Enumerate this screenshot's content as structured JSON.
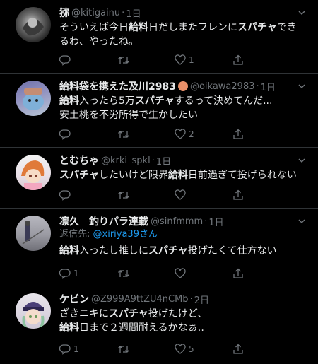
{
  "tweets": [
    {
      "name": "猕",
      "handle": "@kitigainu",
      "sep": "·",
      "time": "1日",
      "lines": [
        [
          {
            "t": "そういえば今日"
          },
          {
            "t": "給料",
            "b": true
          },
          {
            "t": "日だしまたフレンに"
          },
          {
            "t": "スパチャ",
            "b": true
          },
          {
            "t": "でき"
          }
        ],
        [
          {
            "t": "るわ、やったね。"
          }
        ]
      ],
      "reply_count": "",
      "retweet_count": "",
      "like_count": "1"
    },
    {
      "name": "給料袋を携えた及川2983",
      "handle": "@oikawa2983",
      "sep": "·",
      "time": "1日",
      "lines": [
        [
          {
            "t": "給料",
            "b": true
          },
          {
            "t": "入ったら5万"
          },
          {
            "t": "スパチャ",
            "b": true
          },
          {
            "t": "するって決めてんだ..."
          }
        ],
        [
          {
            "t": "安土桃を不労所得で生かしたい"
          }
        ]
      ],
      "reply_count": "",
      "retweet_count": "",
      "like_count": "2"
    },
    {
      "name": "とむちゃ",
      "handle": "@krki_spkl",
      "sep": "·",
      "time": "1日",
      "lines": [
        [
          {
            "t": "スパチャ",
            "b": true
          },
          {
            "t": "したいけど限界"
          },
          {
            "t": "給料",
            "b": true
          },
          {
            "t": "日前過ぎて投げられない"
          }
        ]
      ],
      "reply_count": "",
      "retweet_count": "",
      "like_count": ""
    },
    {
      "name": "凛久　釣りパラ連載",
      "handle": "@sinfmmm",
      "sep": "·",
      "time": "1日",
      "reply_prefix": "返信先: ",
      "reply_to": "@xiriya39さん",
      "lines": [
        [
          {
            "t": "給料",
            "b": true
          },
          {
            "t": "入ったし推しに"
          },
          {
            "t": "スパチャ",
            "b": true
          },
          {
            "t": "投げたくて仕方ない"
          }
        ]
      ],
      "reply_count": "1",
      "retweet_count": "",
      "like_count": ""
    },
    {
      "name": "ケビン",
      "handle": "@Z999A9ttZU4nCMb",
      "sep": "·",
      "time": "2日",
      "lines": [
        [
          {
            "t": "ざきニキに"
          },
          {
            "t": "スパチャ",
            "b": true
          },
          {
            "t": "投げたけど、"
          }
        ],
        [
          {
            "t": "給料",
            "b": true
          },
          {
            "t": "日まで２週間耐えるかなぁ‥"
          }
        ]
      ],
      "reply_count": "1",
      "retweet_count": "",
      "like_count": "5"
    }
  ],
  "colors": {
    "background": "#000000",
    "text": "#e7e9ea",
    "muted": "#71767b",
    "link": "#1d9bf0",
    "divider": "#2f3336"
  },
  "icons": [
    "reply-icon",
    "retweet-icon",
    "like-icon",
    "share-icon",
    "chevron-down-icon"
  ]
}
